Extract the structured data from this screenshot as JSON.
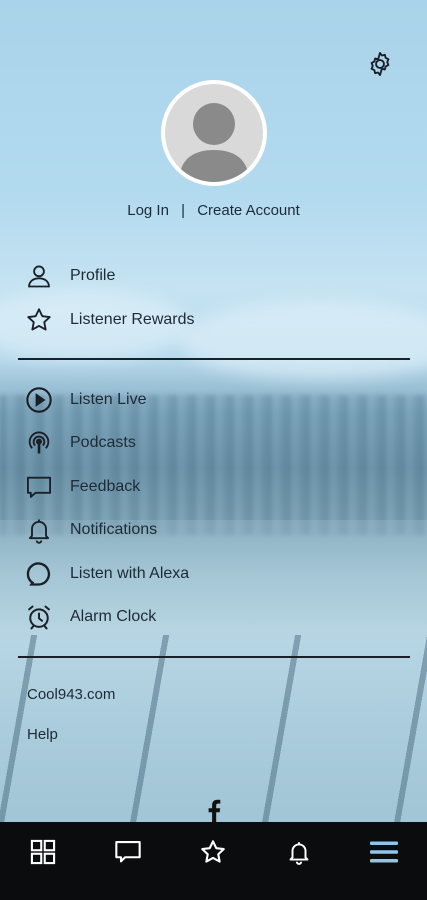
{
  "auth": {
    "login_label": "Log In",
    "create_label": "Create Account"
  },
  "menu_primary": [
    {
      "label": "Profile",
      "icon": "person-icon"
    },
    {
      "label": "Listener Rewards",
      "icon": "star-icon"
    }
  ],
  "menu_secondary": [
    {
      "label": "Listen Live",
      "icon": "play-circle-icon"
    },
    {
      "label": "Podcasts",
      "icon": "podcast-icon"
    },
    {
      "label": "Feedback",
      "icon": "feedback-icon"
    },
    {
      "label": "Notifications",
      "icon": "bell-icon"
    },
    {
      "label": "Listen with Alexa",
      "icon": "alexa-icon"
    },
    {
      "label": "Alarm Clock",
      "icon": "alarm-clock-icon"
    }
  ],
  "links": [
    {
      "label": "Cool943.com"
    },
    {
      "label": "Help"
    }
  ],
  "social": {
    "icon": "facebook-icon"
  },
  "tabbar": [
    {
      "name": "home",
      "icon": "grid-icon"
    },
    {
      "name": "messages",
      "icon": "chat-icon"
    },
    {
      "name": "rewards",
      "icon": "star-icon"
    },
    {
      "name": "notifications",
      "icon": "bell-icon"
    },
    {
      "name": "menu",
      "icon": "hamburger-icon",
      "active": true
    }
  ],
  "colors": {
    "tabbar_bg": "#0b0c0e",
    "tab_icon": "#ffffff",
    "tab_active": "#8ec6ea",
    "text": "#1f2a36"
  }
}
